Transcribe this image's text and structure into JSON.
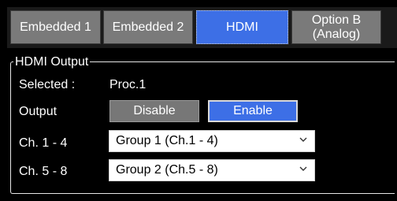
{
  "tabs": [
    {
      "label": "Embedded 1"
    },
    {
      "label": "Embedded 2"
    },
    {
      "label": "HDMI",
      "active": true
    },
    {
      "label_lines": [
        "Option B",
        "(Analog)"
      ]
    }
  ],
  "panel": {
    "group_title": "HDMI Output",
    "selected_label": "Selected :",
    "selected_value": "Proc.1",
    "output_label": "Output",
    "disable_label": "Disable",
    "enable_label": "Enable",
    "output_state": "Enable",
    "ch14_label": "Ch. 1 - 4",
    "ch14_value": "Group 1 (Ch.1 - 4)",
    "ch58_label": "Ch. 5 - 8",
    "ch58_value": "Group 2 (Ch.5 - 8)"
  },
  "colors": {
    "accent": "#3d6fe6",
    "tab_inactive": "#7a7a7a",
    "background": "#000000"
  },
  "icons": {
    "dropdown": "chevron-down-icon"
  }
}
